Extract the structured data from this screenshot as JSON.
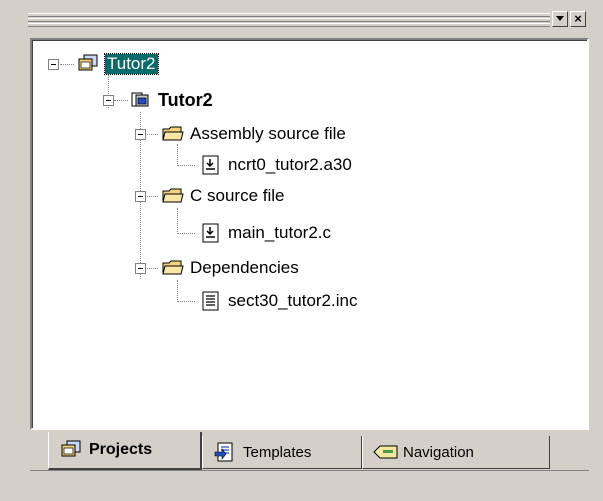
{
  "window": {
    "toolbar_menu_icon": "dropdown-arrow-icon",
    "close_glyph": "×"
  },
  "tree": {
    "workspace": {
      "label": "Tutor2",
      "icon": "workspace-icon"
    },
    "project": {
      "label": "Tutor2",
      "icon": "project-icon"
    },
    "folders": [
      {
        "label": "Assembly source file",
        "icon": "folder-icon",
        "file": "ncrt0_tutor2.a30",
        "file_icon": "source-file-icon"
      },
      {
        "label": "C source file",
        "icon": "folder-icon",
        "file": "main_tutor2.c",
        "file_icon": "source-file-icon"
      },
      {
        "label": "Dependencies",
        "icon": "folder-icon",
        "file": "sect30_tutor2.inc",
        "file_icon": "text-file-icon"
      }
    ]
  },
  "tabs": [
    {
      "label": "Projects",
      "icon": "projects-icon",
      "active": true
    },
    {
      "label": "Templates",
      "icon": "templates-icon",
      "active": false
    },
    {
      "label": "Navigation",
      "icon": "navigation-icon",
      "active": false
    }
  ],
  "colors": {
    "face": "#d4d0c8",
    "selection": "#0a6b6b",
    "folder": "#f2d27a"
  }
}
